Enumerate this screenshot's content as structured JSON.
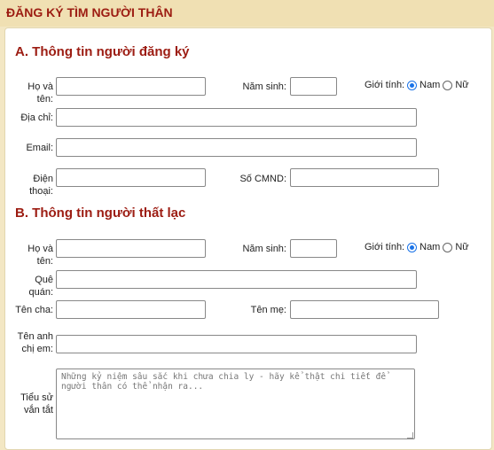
{
  "header": {
    "title": "ĐĂNG KÝ TÌM NGƯỜI THÂN"
  },
  "section_a": {
    "title": "A. Thông tin người đăng ký",
    "fullname_label": "Họ và tên:",
    "birthyear_label": "Năm sinh:",
    "gender_label": "Giới tính:",
    "gender_male": "Nam",
    "gender_female": "Nữ",
    "gender_selected": "Nam",
    "address_label": "Địa chỉ:",
    "email_label": "Email:",
    "phone_label": "Điện thoại:",
    "id_label": "Số CMND:"
  },
  "section_b": {
    "title": "B. Thông tin người thất lạc",
    "fullname_label": "Họ và tên:",
    "birthyear_label": "Năm sinh:",
    "gender_label": "Giới tính:",
    "gender_male": "Nam",
    "gender_female": "Nữ",
    "gender_selected": "Nam",
    "hometown_label": "Quê quán:",
    "father_label": "Tên cha:",
    "mother_label": "Tên mẹ:",
    "siblings_label_line1": "Tên anh",
    "siblings_label_line2": "chị em:",
    "bio_label_line1": "Tiểu sử",
    "bio_label_line2": "vắn tắt",
    "bio_placeholder": "Những kỷ niệm sâu sắc khi chưa chia ly - hãy kể thật chi tiết để người thân có thể nhận ra..."
  }
}
